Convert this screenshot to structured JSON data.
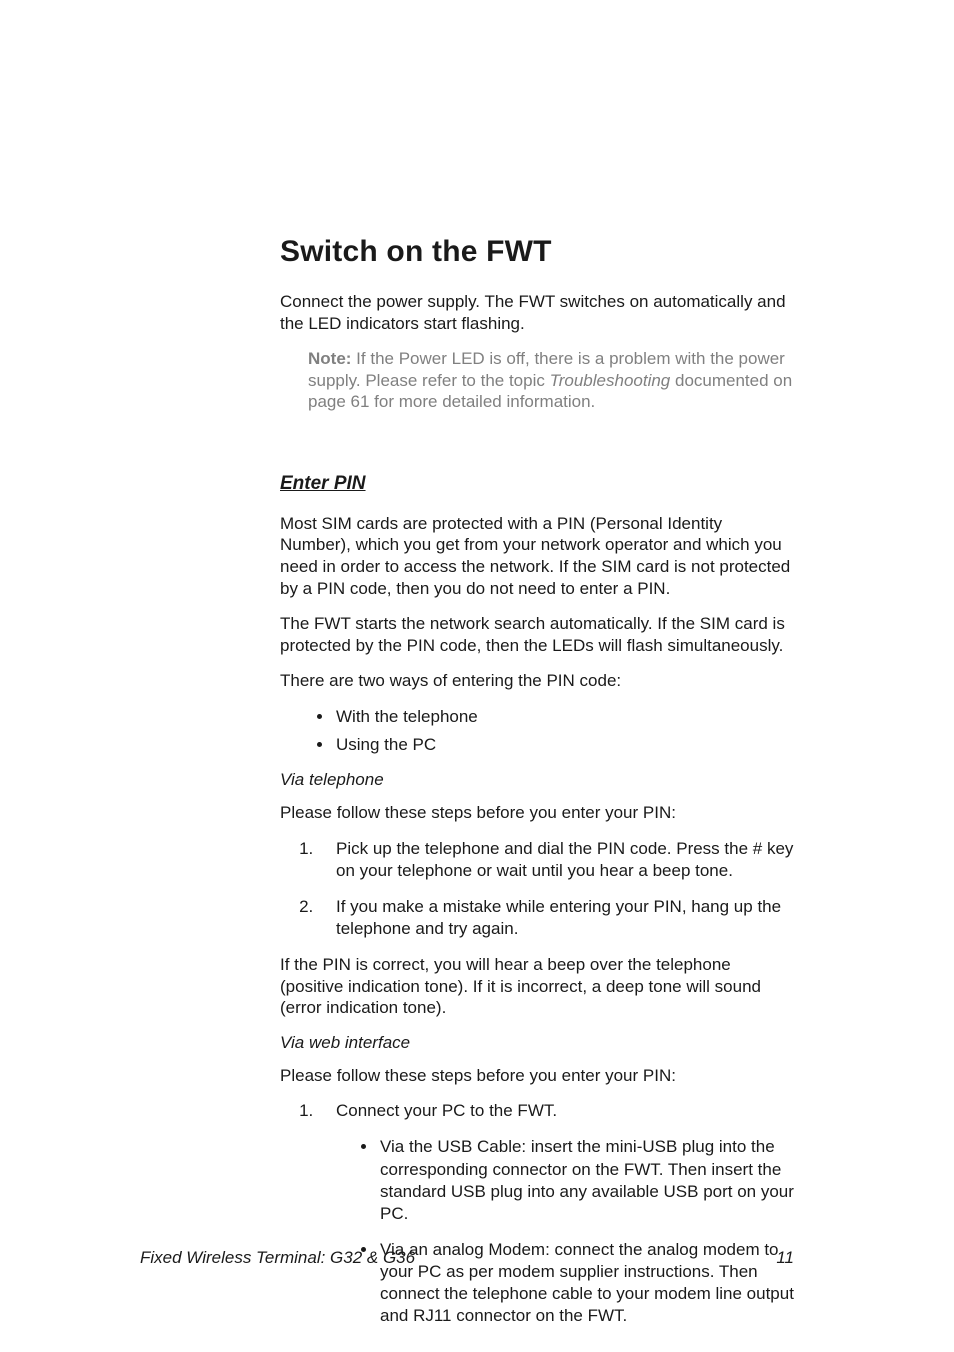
{
  "heading": "Switch on the FWT",
  "intro": "Connect the power supply. The FWT switches on automatically and the LED indicators start flashing.",
  "note": {
    "label": "Note:",
    "before_topic": " If the Power LED is off, there is a problem with the power supply. Please refer to the topic ",
    "topic": "Troubleshooting",
    "after_topic": " documented on page 61 for more detailed information."
  },
  "enter_pin": {
    "title": "Enter PIN",
    "p1": "Most SIM cards are protected with a PIN (Personal Identity Number), which you get from your network operator and which you need in order to access the network. If the SIM card is not protected by a PIN code, then you do not need to enter a PIN.",
    "p2": "The FWT starts the network search automatically. If the SIM card is protected by the PIN code, then the LEDs will flash simultaneously.",
    "p3": "There are two ways of entering the PIN code:",
    "ways": [
      "With the telephone",
      "Using the PC"
    ],
    "via_telephone": {
      "title": "Via telephone",
      "intro": "Please follow these steps before you enter your PIN:",
      "steps": [
        "Pick up the telephone and dial the PIN code. Press the # key on your telephone or wait until you hear a beep tone.",
        "If you make a mistake while entering your PIN, hang up the telephone and try again."
      ],
      "result": "If the PIN is correct, you will hear a beep over the telephone (positive indication tone). If it is incorrect, a deep tone will sound (error indication tone)."
    },
    "via_web": {
      "title": "Via web interface",
      "intro": "Please follow these steps before you enter your PIN:",
      "step1": "Connect your PC to the FWT.",
      "substeps": [
        "Via the USB Cable: insert the mini-USB plug into the corresponding connector on the FWT. Then insert the standard USB plug into any available USB port on your PC.",
        "Via an analog Modem: connect the analog modem to your PC as per modem supplier instructions. Then connect the telephone cable to your modem line output and RJ11 connector on the FWT."
      ]
    }
  },
  "footer": {
    "left": "Fixed Wireless Terminal: G32 & G36",
    "right": "11"
  }
}
